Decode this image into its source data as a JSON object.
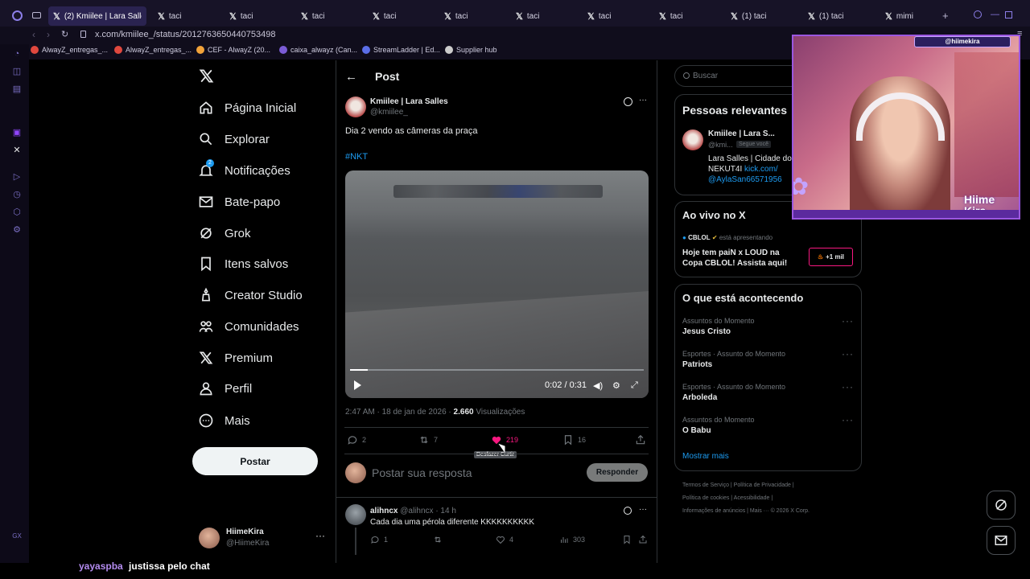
{
  "browser": {
    "tabs": [
      {
        "label": "(2) Kmiilee | Lara Salles",
        "active": true
      },
      {
        "label": "taci",
        "active": false
      },
      {
        "label": "taci",
        "active": false
      },
      {
        "label": "taci",
        "active": false
      },
      {
        "label": "taci",
        "active": false
      },
      {
        "label": "taci",
        "active": false
      },
      {
        "label": "taci",
        "active": false
      },
      {
        "label": "taci",
        "active": false
      },
      {
        "label": "taci",
        "active": false
      },
      {
        "label": "(1) taci",
        "active": false
      },
      {
        "label": "(1) taci",
        "active": false
      },
      {
        "label": "mimi",
        "active": false
      }
    ],
    "url": "x.com/kmiilee_/status/2012763650440753498",
    "bookmarks": [
      {
        "label": "AlwayZ_entregas_...",
        "color": "#e0483e"
      },
      {
        "label": "AlwayZ_entregas_...",
        "color": "#e0483e"
      },
      {
        "label": "CEF - AlwayZ (20...",
        "color": "#f2a33a"
      },
      {
        "label": "caixa_alwayz (Can...",
        "color": "#7b5cd6"
      },
      {
        "label": "StreamLadder | Ed...",
        "color": "#5b6ee8"
      },
      {
        "label": "Supplier hub",
        "color": "#cccccc"
      }
    ]
  },
  "nav": {
    "items": [
      {
        "label": "Página Inicial",
        "icon": "home-icon"
      },
      {
        "label": "Explorar",
        "icon": "search-icon"
      },
      {
        "label": "Notificações",
        "icon": "bell-icon",
        "badge": "2"
      },
      {
        "label": "Bate-papo",
        "icon": "mail-icon"
      },
      {
        "label": "Grok",
        "icon": "grok-icon"
      },
      {
        "label": "Itens salvos",
        "icon": "bookmark-icon"
      },
      {
        "label": "Creator Studio",
        "icon": "creator-icon"
      },
      {
        "label": "Comunidades",
        "icon": "communities-icon"
      },
      {
        "label": "Premium",
        "icon": "x-logo-icon"
      },
      {
        "label": "Perfil",
        "icon": "person-icon"
      },
      {
        "label": "Mais",
        "icon": "more-icon"
      }
    ],
    "post_button": "Postar",
    "account": {
      "name": "HiimeKira",
      "handle": "@HiimeKira"
    }
  },
  "post": {
    "header": "Post",
    "author_name": "Kmiilee | Lara Salles",
    "author_handle": "@kmiilee_",
    "text": "Dia 2 vendo as câmeras da praça",
    "hashtag": "#NKT",
    "video_time": "0:02 / 0:31",
    "video_progress": 0.06,
    "meta_time": "2:47 AM · 18 de jan de 2026 · ",
    "views_count": "2.660",
    "views_label": " Visualizações",
    "replies": "2",
    "reposts": "7",
    "likes": "219",
    "bookmarks": "16",
    "tooltip": "Desfazer Curtir",
    "reply_placeholder": "Postar sua resposta",
    "reply_button": "Responder"
  },
  "reply": {
    "author_name": "alihncx",
    "author_handle": "@alihncx",
    "time": "· 14 h",
    "text": "Cada dia uma pérola diferente KKKKKKKKKK",
    "replies": "1",
    "likes": "4",
    "views": "303"
  },
  "right": {
    "search_placeholder": "Buscar",
    "relevant_title": "Pessoas relevantes",
    "relevant_name": "Kmiilee | Lara S...",
    "relevant_handle": "@kmi...",
    "relevant_follows": "Segue você",
    "relevant_bio_1": "Lara Salles | Cidade do",
    "relevant_bio_2": "NEKUT4I",
    "relevant_link": "kick.com/",
    "relevant_mention": "@AylaSan66571956",
    "live_title": "Ao vivo no X",
    "live_account": "CBLOL",
    "live_presenting": "está apresentando",
    "live_text": "Hoje tem paiN x LOUD na Copa CBLOL! Assista aqui!",
    "live_count": "+1 mil",
    "trends_title": "O que está acontecendo",
    "trends": [
      {
        "context": "Assuntos do Momento",
        "name": "Jesus Cristo"
      },
      {
        "context": "Esportes · Assunto do Momento",
        "name": "Patriots"
      },
      {
        "context": "Esportes · Assunto do Momento",
        "name": "Arboleda"
      },
      {
        "context": "Assuntos do Momento",
        "name": "O Babu"
      }
    ],
    "show_more": "Mostrar mais",
    "footer_1": "Termos de Serviço  |  Política de Privacidade  |",
    "footer_2": "Política de cookies  |  Acessibilidade  |",
    "footer_3": "Informações de anúncios  |  Mais ···  © 2026 X Corp."
  },
  "stream": {
    "handle": "@hiimekira",
    "brand_1": "Hiime",
    "brand_2": "Kira",
    "chat_user": "yayaspba",
    "chat_message": "justissa pelo chat",
    "chat_user_color": "#b48cf0"
  }
}
